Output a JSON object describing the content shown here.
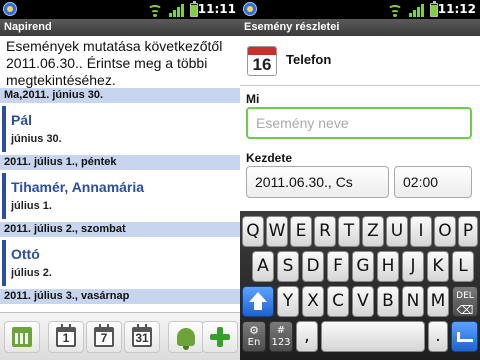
{
  "left": {
    "status_time": "11:11",
    "title": "Napirend",
    "info_text": "Események mutatása következőtől 2011.06.30.. Érintse meg a többi megtekintéséhez.",
    "days": [
      {
        "header": "Ma,2011. június 30.",
        "events": [
          {
            "name": "Pál",
            "date": "június 30."
          }
        ]
      },
      {
        "header": "2011. július 1., péntek",
        "events": [
          {
            "name": "Tihamér, Annamária",
            "date": "július 1."
          }
        ]
      },
      {
        "header": "2011. július 2., szombat",
        "events": [
          {
            "name": "Ottó",
            "date": "július 2."
          }
        ]
      },
      {
        "header": "2011. július 3., vasárnap",
        "events": []
      }
    ],
    "toolbar": {
      "day_view": "1",
      "week_view": "7",
      "month_view": "31",
      "icons": [
        "agenda-grid-icon",
        "day-calendar-icon",
        "week-calendar-icon",
        "month-calendar-icon",
        "alarm-bell-icon",
        "add-plus-icon"
      ]
    }
  },
  "right": {
    "status_time": "11:12",
    "title": "Esemény részletei",
    "calendar_day": "16",
    "calendar_name": "Telefon",
    "what_label": "Mi",
    "name_placeholder": "Esemény neve",
    "start_label": "Kezdete",
    "start_date": "2011.06.30., Cs",
    "start_time": "02:00",
    "keyboard": {
      "row1": [
        "Q",
        "W",
        "E",
        "R",
        "T",
        "Z",
        "U",
        "I",
        "O",
        "P"
      ],
      "row2": [
        "A",
        "S",
        "D",
        "F",
        "G",
        "H",
        "J",
        "K",
        "L"
      ],
      "row3": [
        "Y",
        "X",
        "C",
        "V",
        "B",
        "N",
        "M"
      ],
      "del_label": "DEL",
      "settings_label": "En",
      "symbols_label": "#\n123",
      "comma": ",",
      "period": "."
    }
  },
  "colors": {
    "accent_blue": "#2b4ea3",
    "header_blue": "#c7d6ee",
    "focus_green": "#6bcf45"
  }
}
